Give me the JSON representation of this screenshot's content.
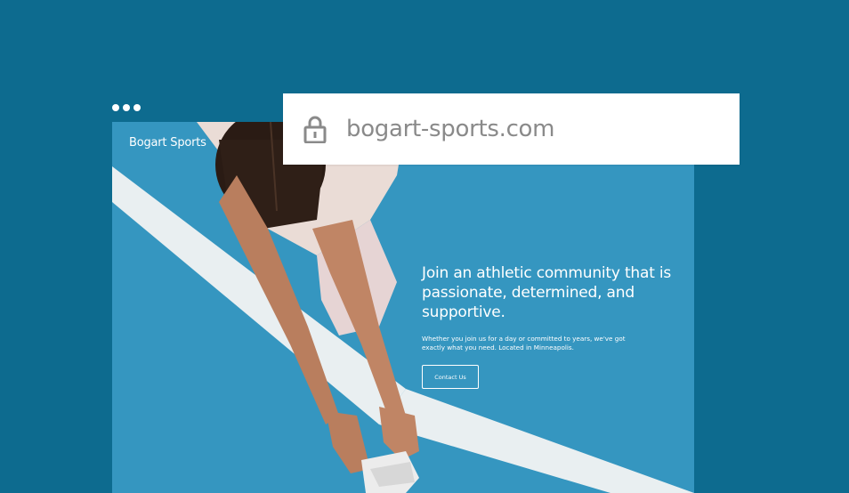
{
  "browser": {
    "url": "bogart-sports.com",
    "icons": {
      "security": "lock-icon",
      "window_controls": "dots-icon"
    }
  },
  "site": {
    "brand": "Bogart Sports",
    "hero": {
      "headline": "Join an athletic community that is passionate, determined, and supportive.",
      "subtext": "Whether you join us for a day or committed to years, we've got exactly what you need. Located in Minneapolis.",
      "cta_label": "Contact Us"
    }
  },
  "colors": {
    "background": "#0d6b8f",
    "track_blue": "#3596c0",
    "address_bar": "#ffffff",
    "url_text": "#8a8a8a"
  }
}
